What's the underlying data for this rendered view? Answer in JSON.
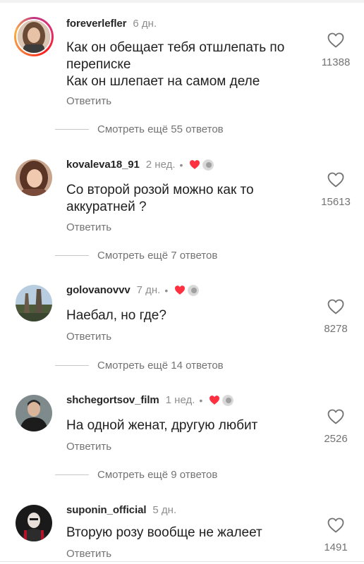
{
  "comments": [
    {
      "username": "foreverlefler",
      "time": "6 дн.",
      "text_lines": [
        "Как он обещает тебя отшлепать по",
        "переписке",
        "Как он шлепает на самом деле"
      ],
      "reply_label": "Ответить",
      "likes": "11388",
      "view_replies": "Смотреть ещё 55 ответов",
      "creator_liked": false
    },
    {
      "username": "kovaleva18_91",
      "time": "2 нед.",
      "separator": "•",
      "text_lines": [
        "Со второй розой можно как то",
        "аккуратней ?"
      ],
      "reply_label": "Ответить",
      "likes": "15613",
      "view_replies": "Смотреть ещё 7 ответов",
      "creator_liked": true
    },
    {
      "username": "golovanovvv",
      "time": "7 дн.",
      "separator": "•",
      "text_lines": [
        "Наебал, но где?"
      ],
      "reply_label": "Ответить",
      "likes": "8278",
      "view_replies": "Смотреть ещё 14 ответов",
      "creator_liked": true
    },
    {
      "username": "shchegortsov_film",
      "time": "1 нед.",
      "separator": "•",
      "text_lines": [
        "На одной женат, другую любит"
      ],
      "reply_label": "Ответить",
      "likes": "2526",
      "view_replies": "Смотреть ещё 9 ответов",
      "creator_liked": true
    },
    {
      "username": "suponin_official",
      "time": "5 дн.",
      "text_lines": [
        "Вторую розу вообще не жалеет"
      ],
      "reply_label": "Ответить",
      "likes": "1491",
      "creator_liked": false
    }
  ],
  "colors": {
    "liked_heart": "#ff3040",
    "muted_text": "#737373",
    "story_ring": "#e1306c"
  },
  "icons": {
    "like": "heart-outline-icon",
    "creator_liked": "heart-filled-icon"
  }
}
